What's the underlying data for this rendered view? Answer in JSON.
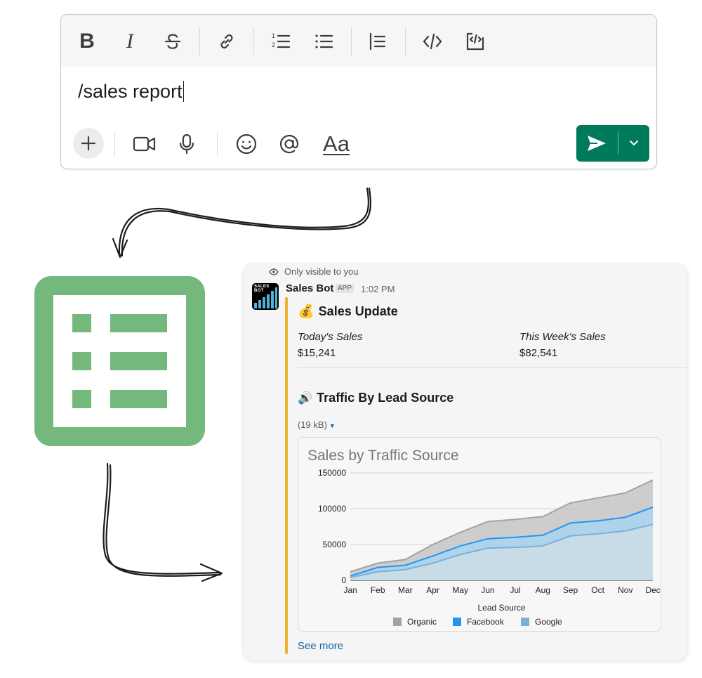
{
  "composer": {
    "message_text": "/sales report",
    "format_buttons": [
      "bold",
      "italic",
      "strikethrough",
      "link",
      "ordered-list",
      "bulleted-list",
      "blockquote",
      "code",
      "code-block"
    ],
    "format_symbols": {
      "bold": "B",
      "italic": "I",
      "ordered_list_nums": [
        "1",
        "2"
      ]
    },
    "aa_label": "Aa",
    "send_color": "#007a5a"
  },
  "sheets_icon": {
    "color": "#74b97b"
  },
  "message": {
    "visibility_note": "Only visible to you",
    "avatar_text": [
      "SALES",
      "BOT"
    ],
    "bot_name": "Sales Bot",
    "app_badge": "APP",
    "time": "1:02 PM",
    "attachment_color": "#ecb22e",
    "section1": {
      "emoji": "💰",
      "title": "Sales Update"
    },
    "fields": [
      {
        "label": "Today's Sales",
        "value": "$15,241"
      },
      {
        "label": "This Week's Sales",
        "value": "$82,541"
      }
    ],
    "section2": {
      "emoji": "🔊",
      "title": "Traffic By Lead Source"
    },
    "file_size": "(19 kB)",
    "see_more": "See more"
  },
  "chart_data": {
    "type": "area",
    "title": "Sales by Traffic Source",
    "xlabel": "Lead Source",
    "ylabel": "",
    "categories": [
      "Jan",
      "Feb",
      "Mar",
      "Apr",
      "May",
      "Jun",
      "Jul",
      "Aug",
      "Sep",
      "Oct",
      "Nov",
      "Dec"
    ],
    "ylim": [
      0,
      150000
    ],
    "yticks": [
      0,
      50000,
      100000,
      150000
    ],
    "ytick_labels": [
      "0",
      "50000",
      "100000",
      "150000"
    ],
    "grid": true,
    "legend_position": "bottom",
    "stacked": false,
    "series": [
      {
        "name": "Organic",
        "color": "#a3a3a3",
        "fill": "#c5c5c5",
        "values": [
          12000,
          24000,
          29000,
          50000,
          67000,
          82000,
          85000,
          89000,
          108000,
          115000,
          122000,
          140000
        ]
      },
      {
        "name": "Facebook",
        "color": "#2196f3",
        "fill": "#a9d4f0",
        "values": [
          6000,
          18000,
          21000,
          34000,
          48000,
          58000,
          60000,
          63000,
          80000,
          83000,
          88000,
          102000
        ]
      },
      {
        "name": "Google",
        "color": "#79b1d6",
        "fill": "#cddde8",
        "values": [
          4000,
          12000,
          15000,
          24000,
          36000,
          45000,
          46000,
          48000,
          62000,
          65000,
          69000,
          78000
        ]
      }
    ]
  }
}
